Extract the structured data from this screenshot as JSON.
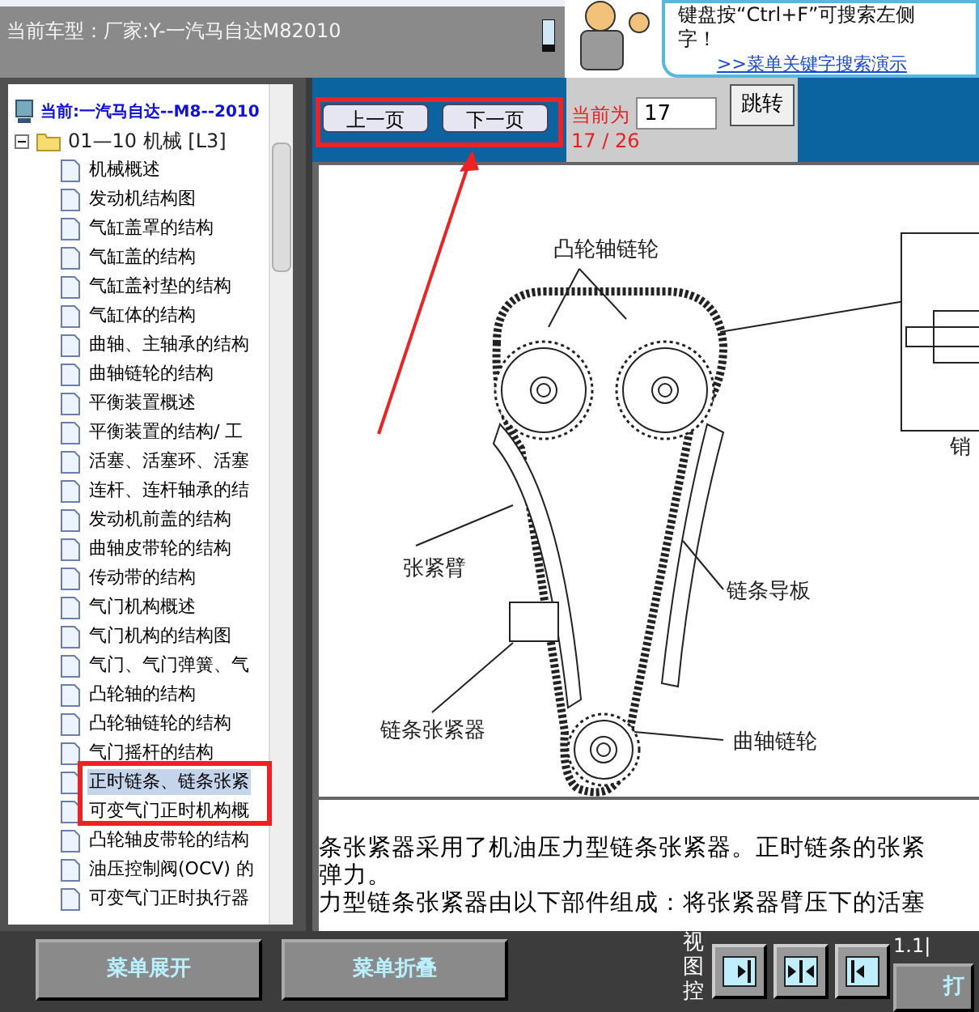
{
  "header": {
    "vehicle": "当前车型：厂家:Y-一汽马自达M82010",
    "tip_line_1": "键盘按“Ctrl+F”可搜索左侧",
    "tip_line_2": "字！",
    "tip_link": ">>菜单关键字搜索演示"
  },
  "tree": {
    "current": "当前:一汽马自达--M8--2010",
    "folder": {
      "label": "01—10 机械 [L3]",
      "expanded": true
    },
    "items": [
      {
        "label": "机械概述",
        "selected": false
      },
      {
        "label": "发动机结构图",
        "selected": false
      },
      {
        "label": "气缸盖罩的结构",
        "selected": false
      },
      {
        "label": "气缸盖的结构",
        "selected": false
      },
      {
        "label": "气缸盖衬垫的结构",
        "selected": false
      },
      {
        "label": "气缸体的结构",
        "selected": false
      },
      {
        "label": "曲轴、主轴承的结构",
        "selected": false
      },
      {
        "label": "曲轴链轮的结构",
        "selected": false
      },
      {
        "label": "平衡装置概述",
        "selected": false
      },
      {
        "label": "平衡装置的结构/ 工",
        "selected": false
      },
      {
        "label": "活塞、活塞环、活塞",
        "selected": false
      },
      {
        "label": "连杆、连杆轴承的结",
        "selected": false
      },
      {
        "label": "发动机前盖的结构",
        "selected": false
      },
      {
        "label": "曲轴皮带轮的结构",
        "selected": false
      },
      {
        "label": "传动带的结构",
        "selected": false
      },
      {
        "label": "气门机构概述",
        "selected": false
      },
      {
        "label": "气门机构的结构图",
        "selected": false
      },
      {
        "label": "气门、气门弹簧、气",
        "selected": false
      },
      {
        "label": "凸轮轴的结构",
        "selected": false
      },
      {
        "label": "凸轮轴链轮的结构",
        "selected": false
      },
      {
        "label": "气门摇杆的结构",
        "selected": false
      },
      {
        "label": "正时链条、链条张紧",
        "selected": true
      },
      {
        "label": "可变气门正时机构概",
        "selected": false
      },
      {
        "label": "凸轮轴皮带轮的结构",
        "selected": false
      },
      {
        "label": "油压控制阀(OCV) 的",
        "selected": false
      },
      {
        "label": "可变气门正时执行器",
        "selected": false
      }
    ]
  },
  "nav": {
    "prev": "上一页",
    "next": "下一页",
    "current_label": "当前为",
    "page_input": "17",
    "jump": "跳转",
    "page_count": "17 / 26"
  },
  "diagram": {
    "labels": [
      "凸轮轴链轮",
      "张紧臂",
      "链条导板",
      "链条张紧器",
      "曲轴链轮",
      "销"
    ]
  },
  "paragraph_lines": [
    "条张紧器采用了机油压力型链条张紧器。正时链条的张紧",
    "弹力。",
    "力型链条张紧器由以下部件组成：将张紧器臂压下的活塞"
  ],
  "footer": {
    "expand": "菜单展开",
    "collapse": "菜单折叠",
    "view_label": "视图控",
    "zoom": "1.1|",
    "print": "打"
  }
}
